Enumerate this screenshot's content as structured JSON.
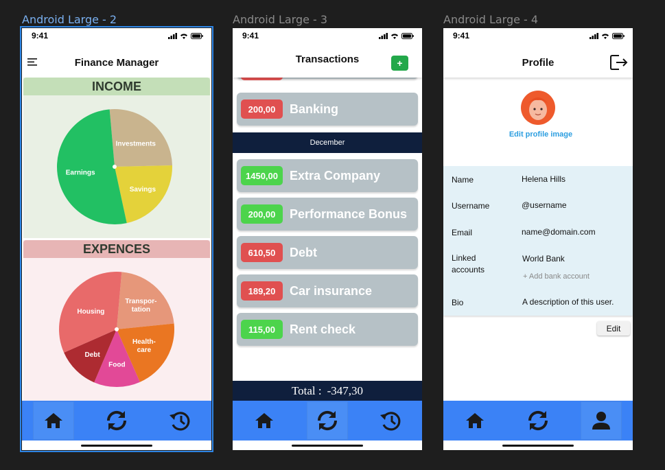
{
  "frames": {
    "finance": "Android Large - 2",
    "transactions": "Android Large - 3",
    "profile": "Android Large - 4"
  },
  "status_time": "9:41",
  "finance_screen": {
    "title": "Finance Manager",
    "income_title": "INCOME",
    "expenses_title": "EXPENCES",
    "income_chart": {
      "type": "pie",
      "labels": [
        "Earnings",
        "Investments",
        "Savings"
      ],
      "values": [
        52,
        26,
        22
      ],
      "colors": [
        "#22c063",
        "#c9b48e",
        "#e4d23a"
      ]
    },
    "expenses_chart": {
      "type": "pie",
      "labels": [
        "Housing",
        "Transpor-tation",
        "Health-care",
        "Food",
        "Debt"
      ],
      "values": [
        33,
        22,
        20,
        13,
        12
      ],
      "colors": [
        "#e86a6a",
        "#e6977a",
        "#ea7622",
        "#e24997",
        "#ad2b31"
      ]
    }
  },
  "transactions_screen": {
    "title": "Transactions",
    "add_label": "+",
    "top_rows": [
      {
        "amount": "200,00",
        "description": "Banking",
        "kind": "red"
      }
    ],
    "month_label": "December",
    "rows": [
      {
        "amount": "1450,00",
        "description": "Extra Company",
        "kind": "green"
      },
      {
        "amount": "200,00",
        "description": "Performance Bonus",
        "kind": "green"
      },
      {
        "amount": "610,50",
        "description": "Debt",
        "kind": "red"
      },
      {
        "amount": "189,20",
        "description": "Car insurance",
        "kind": "red"
      },
      {
        "amount": "115,00",
        "description": "Rent check",
        "kind": "green"
      }
    ],
    "total_label": "Total :",
    "total_value": "-347,30"
  },
  "profile_screen": {
    "title": "Profile",
    "edit_image_label": "Edit profile image",
    "fields": {
      "name_label": "Name",
      "name_value": "Helena Hills",
      "username_label": "Username",
      "username_value": "@username",
      "email_label": "Email",
      "email_value": "name@domain.com",
      "linked_label": "Linked accounts",
      "linked_value": "World Bank",
      "add_bank_label": "+  Add bank account",
      "bio_label": "Bio",
      "bio_value": "A description of this user."
    },
    "edit_button": "Edit"
  },
  "icons": {
    "menu": "menu-icon",
    "home": "home-icon",
    "sync": "sync-icon",
    "history": "history-icon",
    "logout": "logout-icon",
    "person": "person-icon"
  },
  "colors": {
    "nav_blue": "#3b82f6",
    "navy": "#0f1f3d",
    "income_header": "#c4dfb8",
    "expense_header": "#e7b5b5"
  }
}
